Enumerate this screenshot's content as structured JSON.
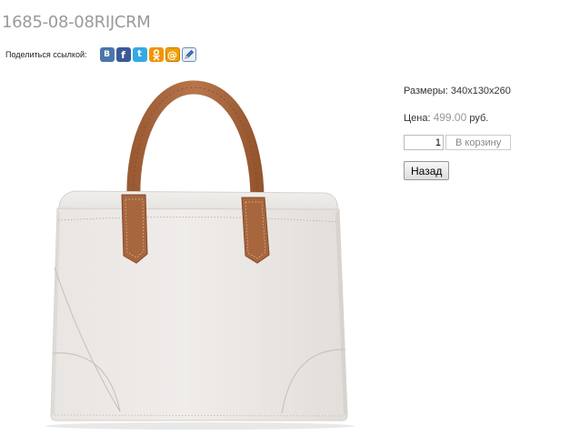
{
  "product": {
    "title": "1685-08-08RIJCRM",
    "image_alt": "product-image"
  },
  "share": {
    "label": "Поделиться ссылкой:",
    "icons": [
      {
        "name": "vkontakte-icon",
        "glyph": "В",
        "color": "#4a76a8"
      },
      {
        "name": "facebook-icon",
        "glyph": "f",
        "color": "#3b5998"
      },
      {
        "name": "twitter-icon",
        "glyph": "t",
        "color": "#33a9e5"
      },
      {
        "name": "odnoklassniki-icon",
        "glyph": "ok",
        "color": "#f29400"
      },
      {
        "name": "mail-ru-icon",
        "glyph": "@",
        "color": "#f0a000"
      },
      {
        "name": "livejournal-icon",
        "glyph": "✎",
        "color": "#6b8eb9"
      }
    ]
  },
  "details": {
    "size_label": "Размеры:",
    "size_value": "340x130x260",
    "price_label": "Цена:",
    "price_value": "499.00",
    "currency": "руб."
  },
  "cart": {
    "quantity": "1",
    "add_label": "В корзину"
  },
  "nav": {
    "back_label": "Назад"
  }
}
